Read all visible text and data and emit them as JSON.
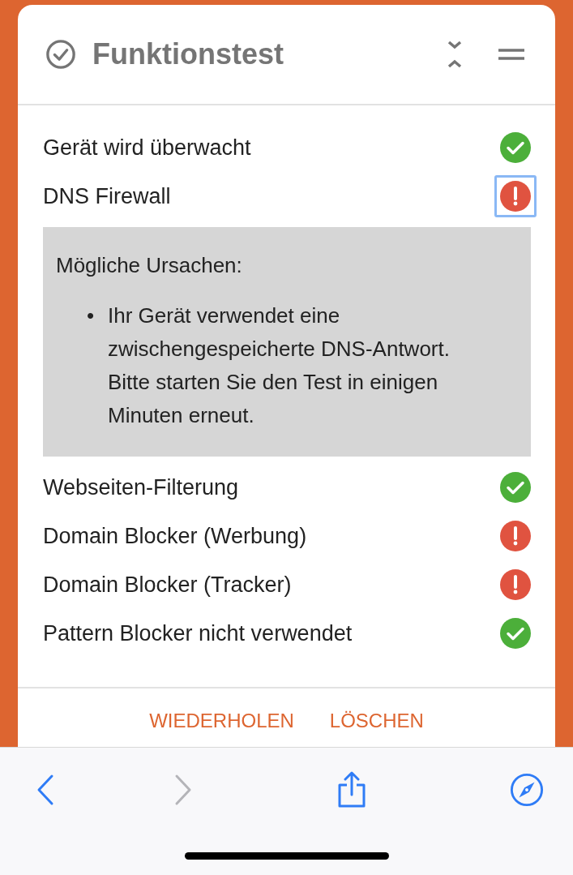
{
  "card": {
    "title": "Funktionstest",
    "items": [
      {
        "label": "Gerät wird überwacht",
        "passed": true,
        "focused": false
      },
      {
        "label": "DNS Firewall",
        "passed": false,
        "focused": true,
        "details": {
          "title": "Mögliche Ursachen:",
          "bullets": [
            {
              "marker": "•",
              "text": "Ihr Gerät verwendet eine zwischengespeicherte DNS-Antwort. Bitte starten Sie den Test in einigen Minuten erneut."
            }
          ]
        }
      },
      {
        "label": "Webseiten-Filterung",
        "passed": true,
        "focused": false
      },
      {
        "label": "Domain Blocker (Werbung)",
        "passed": false,
        "focused": false
      },
      {
        "label": "Domain Blocker (Tracker)",
        "passed": false,
        "focused": false
      },
      {
        "label": "Pattern Blocker nicht verwendet",
        "passed": true,
        "focused": false
      }
    ],
    "actions": [
      "WIEDERHOLEN",
      "LÖSCHEN"
    ]
  },
  "toolbar": [
    {
      "kind": "back",
      "disabled": false
    },
    {
      "kind": "forward",
      "disabled": true
    },
    {
      "kind": "share",
      "disabled": false
    },
    {
      "kind": "compass",
      "disabled": false
    }
  ]
}
